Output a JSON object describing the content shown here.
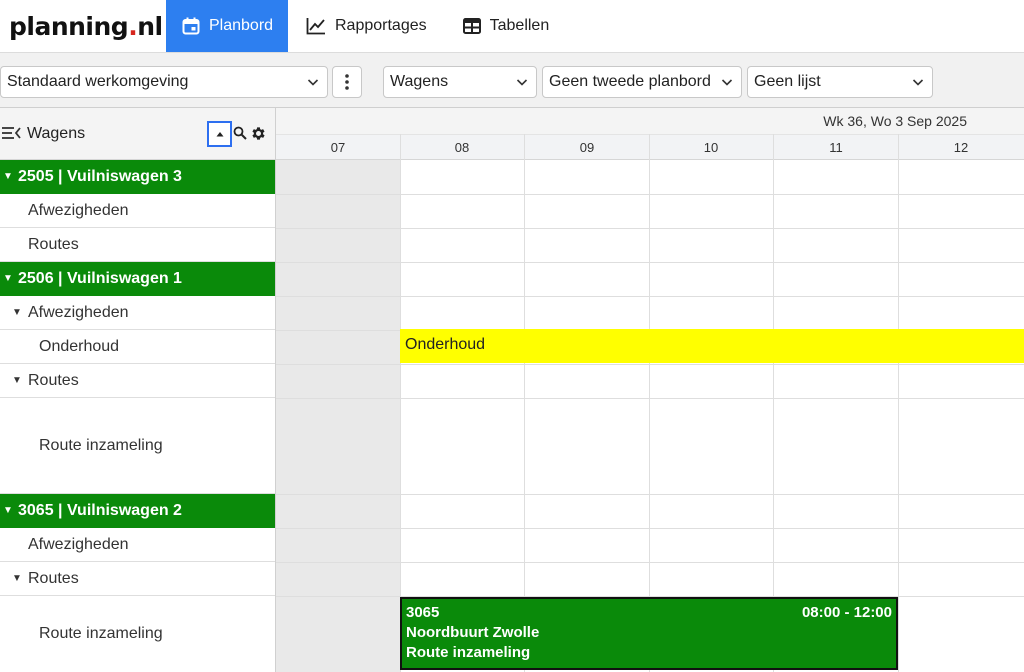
{
  "brand": {
    "logo_main": "planning",
    "logo_dot": ".",
    "logo_tld": "nl"
  },
  "nav": {
    "tabs": [
      {
        "label": "Planbord",
        "icon": "calendar-icon",
        "active": true
      },
      {
        "label": "Rapportages",
        "icon": "line-chart-icon",
        "active": false
      },
      {
        "label": "Tabellen",
        "icon": "table-icon",
        "active": false
      }
    ]
  },
  "toolbar": {
    "workspace": "Standaard werkomgeving",
    "board": "Wagens",
    "second_board": "Geen tweede planbord",
    "list": "Geen lijst"
  },
  "left_panel": {
    "title": "Wagens",
    "rows": [
      {
        "label": "2505 | Vuilniswagen 3",
        "kind": "group"
      },
      {
        "label": "Afwezigheden",
        "kind": "sub"
      },
      {
        "label": "Routes",
        "kind": "sub"
      },
      {
        "label": "2506 | Vuilniswagen 1",
        "kind": "group"
      },
      {
        "label": "Afwezigheden",
        "kind": "sub-expanded"
      },
      {
        "label": "Onderhoud",
        "kind": "leaf"
      },
      {
        "label": "Routes",
        "kind": "sub-expanded"
      },
      {
        "label": "Route inzameling",
        "kind": "leaf"
      },
      {
        "label": "3065 | Vuilniswagen 2",
        "kind": "group"
      },
      {
        "label": "Afwezigheden",
        "kind": "sub"
      },
      {
        "label": "Routes",
        "kind": "sub-expanded"
      },
      {
        "label": "Route inzameling",
        "kind": "leaf"
      }
    ]
  },
  "timeline": {
    "date_label": "Wk 36, Wo 3 Sep 2025",
    "hours": [
      "07",
      "08",
      "09",
      "10",
      "11",
      "12"
    ]
  },
  "events": {
    "maintenance": {
      "label": "Onderhoud",
      "color": "#ffff00"
    },
    "route": {
      "number": "3065",
      "time": "08:00 - 12:00",
      "location": "Noordbuurt Zwolle",
      "type": "Route inzameling",
      "color": "#0a8a0a"
    }
  },
  "colors": {
    "accent": "#2d7ff0",
    "group_green": "#0a8a0a",
    "logo_red": "#d7261e"
  }
}
